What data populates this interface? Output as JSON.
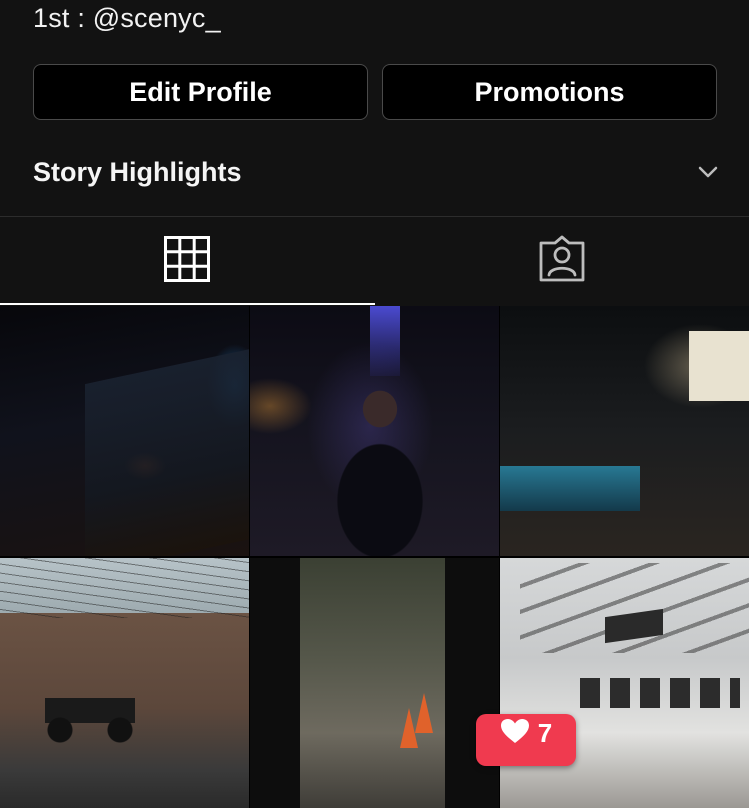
{
  "profile": {
    "bio_line": "1st : @scenyc_",
    "edit_profile_label": "Edit Profile",
    "promotions_label": "Promotions"
  },
  "highlights": {
    "label": "Story Highlights",
    "toggle_icon": "chevron-down-icon"
  },
  "tabs": [
    {
      "name": "posts-grid",
      "icon": "grid-icon",
      "active": true
    },
    {
      "name": "tagged",
      "icon": "person-tag-icon",
      "active": false
    }
  ],
  "grid": {
    "posts": [
      {
        "subject": "neon-signs-night"
      },
      {
        "subject": "person-sitting-night"
      },
      {
        "subject": "storefront-night"
      },
      {
        "subject": "street-motorcycle"
      },
      {
        "subject": "road-traffic-cones"
      },
      {
        "subject": "gallery-interior"
      }
    ]
  },
  "notification": {
    "icon": "heart-icon",
    "count": "7",
    "color": "#f03a4f"
  },
  "colors": {
    "background": "#121212",
    "button_border": "#4a4a4a",
    "accent_like": "#f03a4f"
  }
}
